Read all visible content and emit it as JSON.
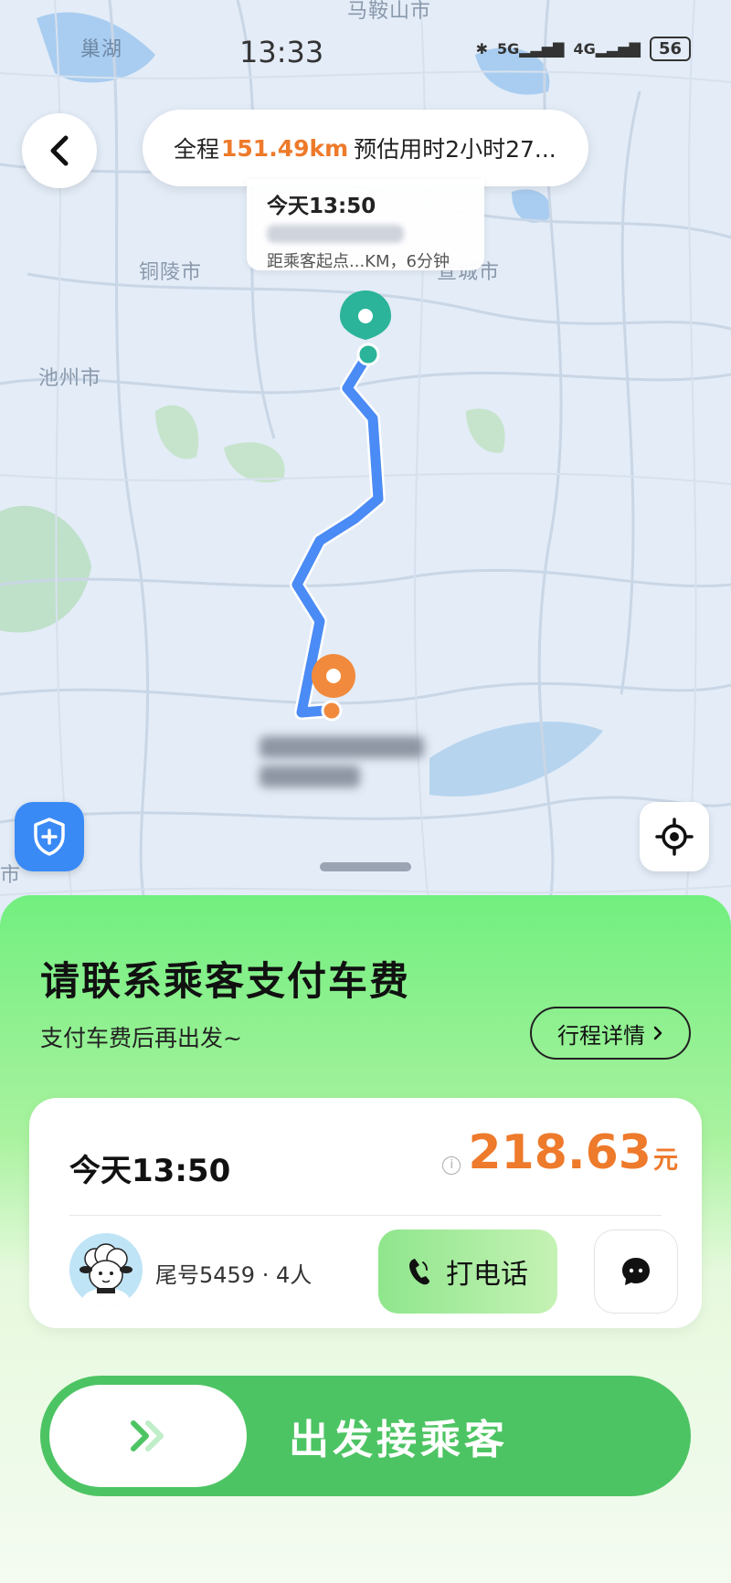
{
  "status_bar": {
    "time": "13:33",
    "network_1": "5G",
    "network_2": "4G",
    "battery": "56"
  },
  "map": {
    "labels": [
      "巢湖",
      "马鞍山市",
      "铜陵市",
      "池州市",
      "宣城市",
      "市"
    ],
    "route_colors": {
      "route": "#4a8bf5",
      "pickup": "#2bb49a",
      "destination": "#f18a3c"
    }
  },
  "route_summary": {
    "prefix": "全程",
    "distance": "151.49km",
    "suffix": "预估用时2小时27..."
  },
  "pickup_popup": {
    "time": "今天13:50",
    "eta": "距乘客起点...KM，6分钟"
  },
  "sheet": {
    "title": "请联系乘客支付车费",
    "subtitle": "支付车费后再出发~",
    "details_button": "行程详情",
    "trip_time": "今天13:50",
    "fare_amount": "218.63",
    "fare_unit": "元",
    "fare_info_icon": "i",
    "passenger": "尾号5459 · 4人",
    "call_button": "打电话",
    "depart_button": "出发接乘客"
  },
  "icons": {
    "back": "chevron-left-icon",
    "shield": "shield-plus-icon",
    "locate": "crosshair-icon",
    "phone": "phone-icon",
    "chat": "chat-bubble-icon",
    "slide": "double-chevron-right-icon"
  }
}
